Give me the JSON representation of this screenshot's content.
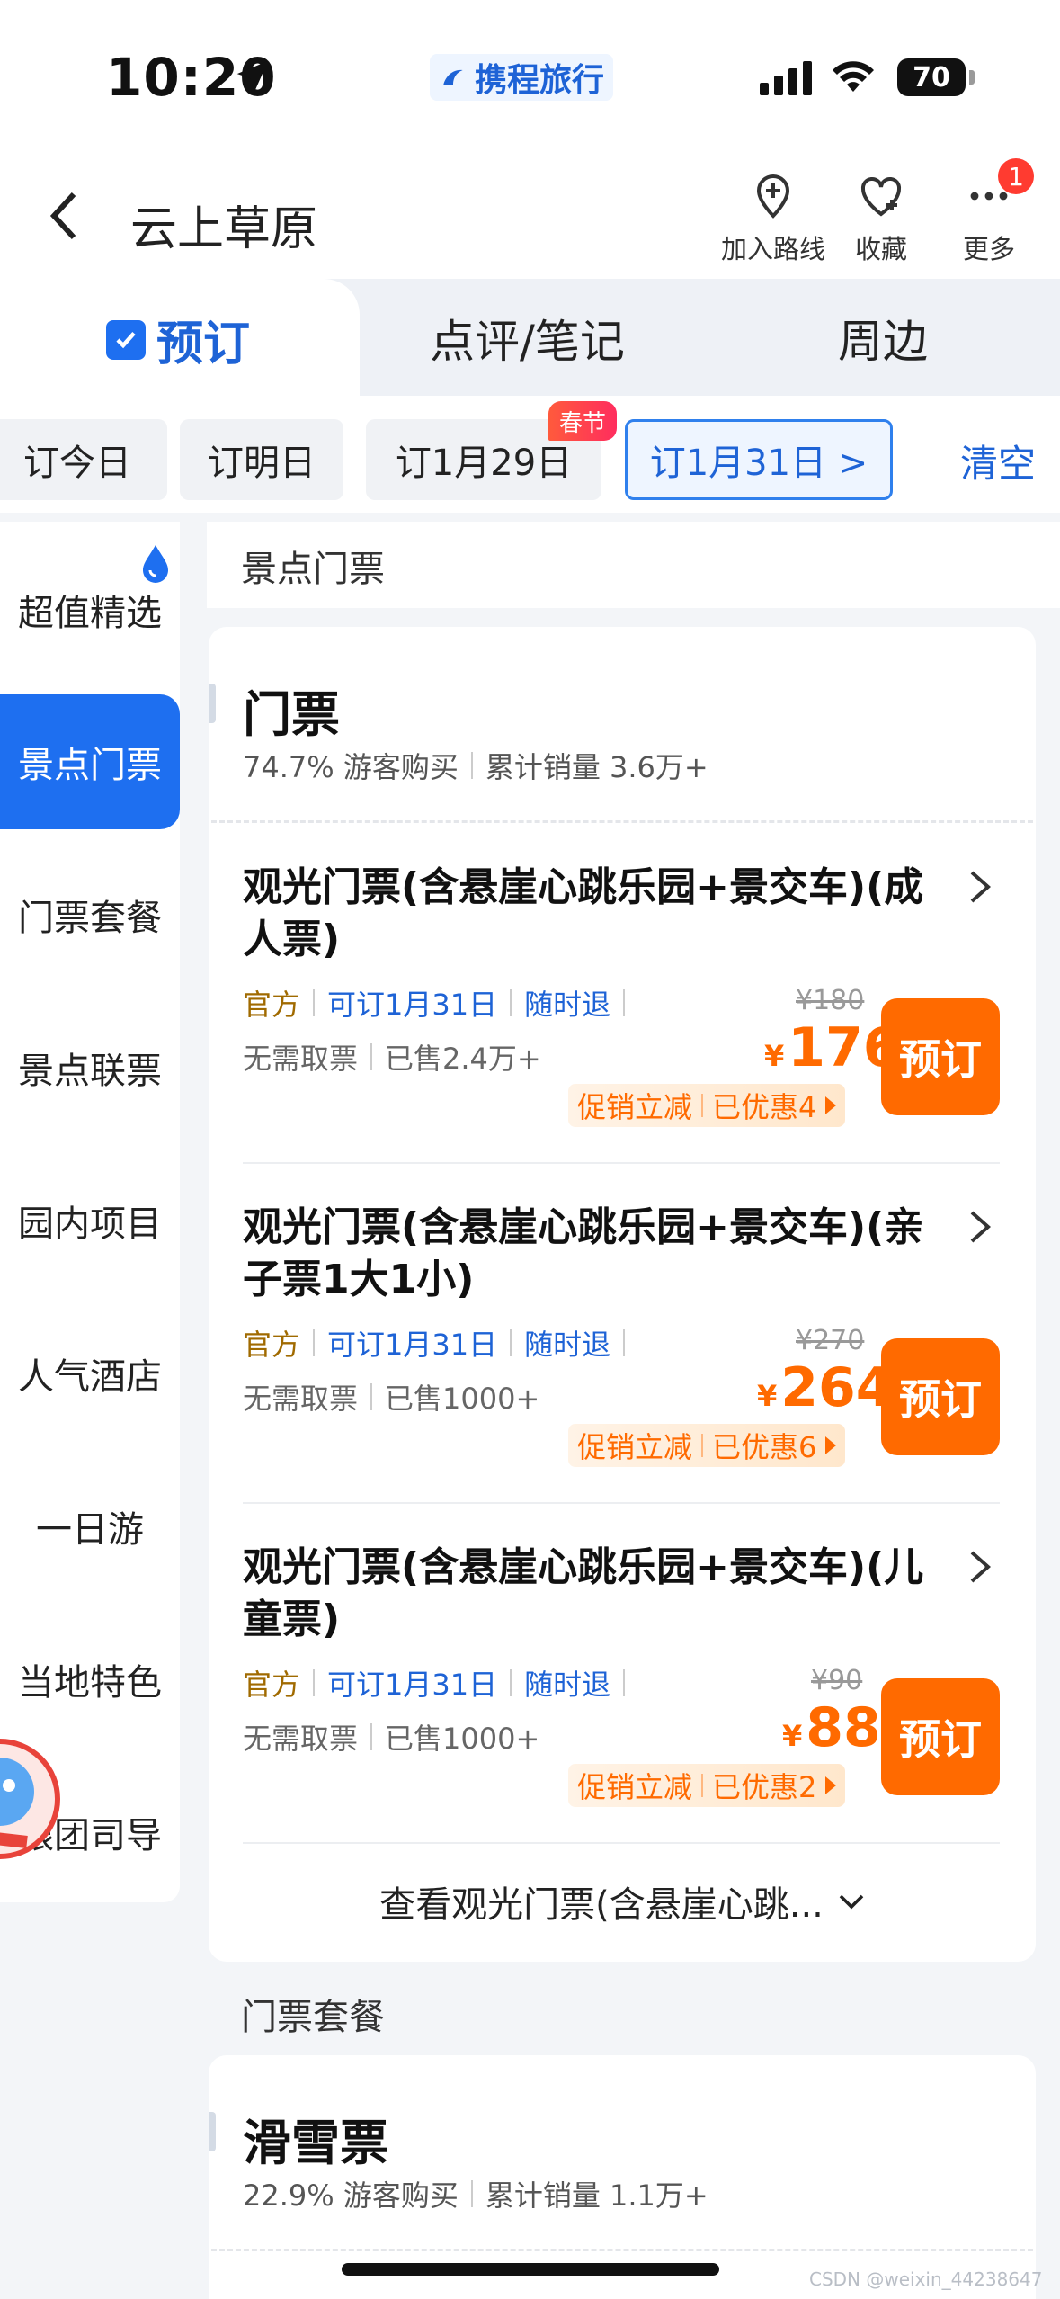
{
  "status_bar": {
    "time": "10:20",
    "battery": "70",
    "app_name": "携程旅行"
  },
  "header": {
    "title": "云上草原",
    "actions": [
      {
        "label": "加入路线",
        "icon": "route-pin-icon"
      },
      {
        "label": "收藏",
        "icon": "heart-plus-icon"
      },
      {
        "label": "更多",
        "icon": "more-dots-icon"
      }
    ],
    "notification_count": "1"
  },
  "tabs": [
    {
      "label": "预订",
      "active": true
    },
    {
      "label": "点评/笔记",
      "active": false
    },
    {
      "label": "周边",
      "active": false
    }
  ],
  "date_chips": {
    "items": [
      "订今日",
      "订明日",
      "订1月29日",
      "订1月31日 >"
    ],
    "selected_index": 3,
    "festival_badge": "春节",
    "clear_label": "清空"
  },
  "left_nav": {
    "items": [
      "超值精选",
      "景点门票",
      "门票套餐",
      "景点联票",
      "园内项目",
      "人气酒店",
      "一日游",
      "当地特色",
      "跟团司导"
    ],
    "active_index": 1
  },
  "sections": {
    "tickets_label": "景点门票",
    "package_label": "门票套餐"
  },
  "ticket_card": {
    "title": "门票",
    "buy_ratio": "74.7% 游客购买",
    "sales_total": "累计销量 3.6万+",
    "items": [
      {
        "name": "观光门票(含悬崖心跳乐园+景交车)(成人票)",
        "tags": [
          "官方",
          "可订1月31日",
          "随时退"
        ],
        "no_pickup": "无需取票",
        "sold": "已售2.4万+",
        "old_price": "¥180",
        "currency": "¥",
        "price": "176",
        "promo": "促销立减",
        "discount": "已优惠4",
        "book_label": "预订"
      },
      {
        "name": "观光门票(含悬崖心跳乐园+景交车)(亲子票1大1小)",
        "tags": [
          "官方",
          "可订1月31日",
          "随时退"
        ],
        "no_pickup": "无需取票",
        "sold": "已售1000+",
        "old_price": "¥270",
        "currency": "¥",
        "price": "264",
        "promo": "促销立减",
        "discount": "已优惠6",
        "book_label": "预订"
      },
      {
        "name": "观光门票(含悬崖心跳乐园+景交车)(儿童票)",
        "tags": [
          "官方",
          "可订1月31日",
          "随时退"
        ],
        "no_pickup": "无需取票",
        "sold": "已售1000+",
        "old_price": "¥90",
        "currency": "¥",
        "price": "88",
        "promo": "促销立减",
        "discount": "已优惠2",
        "book_label": "预订"
      }
    ],
    "view_more": "查看观光门票(含悬崖心跳..."
  },
  "package_card": {
    "title": "滑雪票",
    "buy_ratio": "22.9% 游客购买",
    "sales_total": "累计销量 1.1万+"
  },
  "watermark": "CSDN @weixin_44238647",
  "colors": {
    "accent_blue": "#1e6ff0",
    "accent_orange": "#ff6a00",
    "festival_red": "#ff2d5e"
  }
}
